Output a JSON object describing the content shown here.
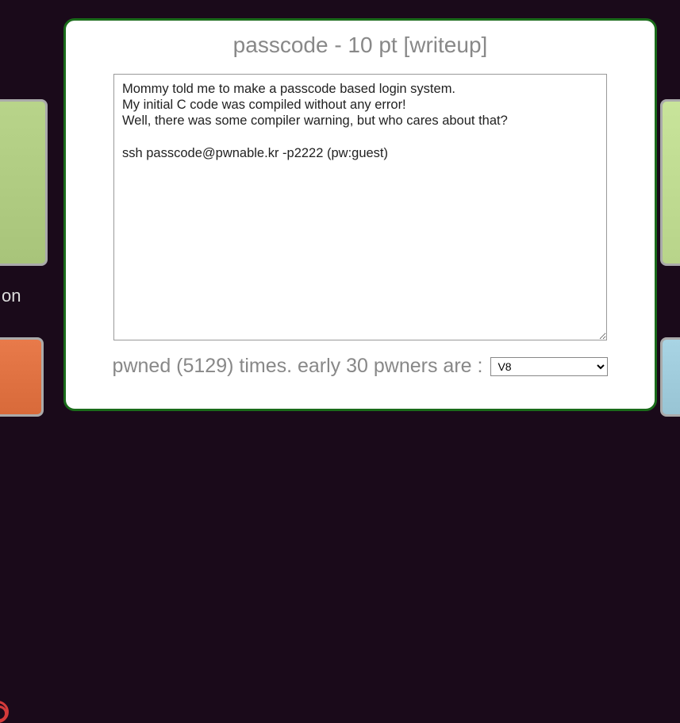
{
  "background": {
    "label_fragment": "on"
  },
  "modal": {
    "title_prefix": "passcode - 10 pt ",
    "writeup_label": "[writeup]",
    "description": "Mommy told me to make a passcode based login system.\nMy initial C code was compiled without any error!\nWell, there was some compiler warning, but who cares about that?\n\nssh passcode@pwnable.kr -p2222 (pw:guest)",
    "pwned_count": 5129,
    "pwned_text_template": "pwned (5129) times. early 30 pwners are :",
    "selected_pwner": "V8",
    "pwner_options": [
      "V8"
    ]
  }
}
